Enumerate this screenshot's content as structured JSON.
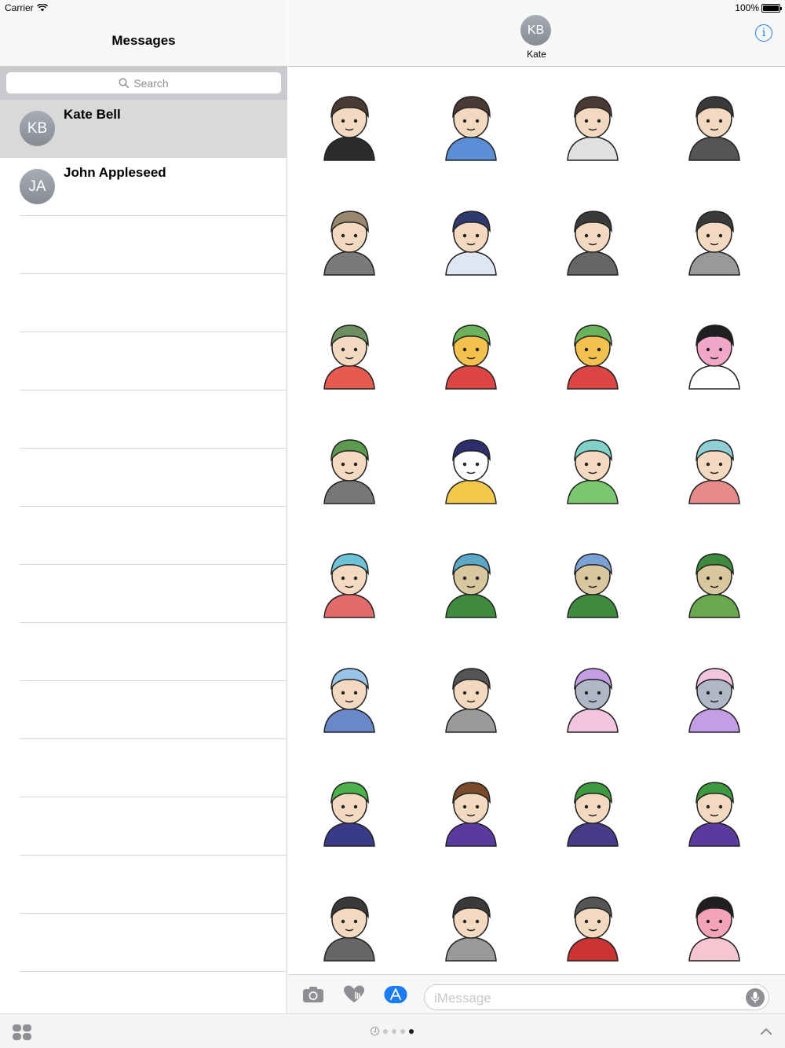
{
  "status_bar": {
    "carrier": "Carrier",
    "battery": "100%",
    "battery_level": 1.0
  },
  "sidebar": {
    "title": "Messages",
    "search_placeholder": "Search",
    "conversations": [
      {
        "initials": "KB",
        "name": "Kate Bell",
        "selected": true
      },
      {
        "initials": "JA",
        "name": "John Appleseed",
        "selected": false
      }
    ]
  },
  "header": {
    "initials": "KB",
    "name": "Kate",
    "info_icon": "info-icon"
  },
  "stickers": [
    "sticker-boy-sparkles",
    "sticker-boy-ok",
    "sticker-boy-surprised",
    "sticker-boy-sleeping-zzz",
    "sticker-boy-hey",
    "sticker-boy-crying",
    "sticker-boy-lying-star",
    "sticker-boy-blank-stare",
    "sticker-couple-kiss",
    "sticker-couple-high-five",
    "sticker-couple-holding-hands",
    "sticker-broken-heart",
    "sticker-boy-forest-ghost",
    "sticker-ghost-flower",
    "sticker-girl-bunny-hood",
    "sticker-girl-bunny-flying",
    "sticker-girl-jumping",
    "sticker-deer-skull-fire",
    "sticker-deer-torch",
    "sticker-deer-thanks",
    "sticker-boy-good-night",
    "sticker-boy-sad-sitting",
    "sticker-robot-hand",
    "sticker-robot-hand-2",
    "sticker-boy-green-monster",
    "sticker-boy-whistle",
    "sticker-boy-cash-thumbs-up",
    "sticker-boy-money-flying",
    "sticker-boy-lying-star-2",
    "sticker-boy-blank-stare-2",
    "sticker-boy-dj-music",
    "sticker-girl-pink-hair"
  ],
  "input_bar": {
    "placeholder": "iMessage",
    "icons": [
      "camera-icon",
      "digital-touch-icon",
      "app-store-icon",
      "microphone-icon"
    ]
  },
  "drawer": {
    "pages": 4,
    "active_page": 4,
    "icons": [
      "app-drawer-icon",
      "recents-icon",
      "chevron-up-icon"
    ]
  },
  "colors": {
    "accent": "#1a7cf5",
    "selected_row": "#d9d9d9",
    "search_bg": "#c9c9ce"
  }
}
